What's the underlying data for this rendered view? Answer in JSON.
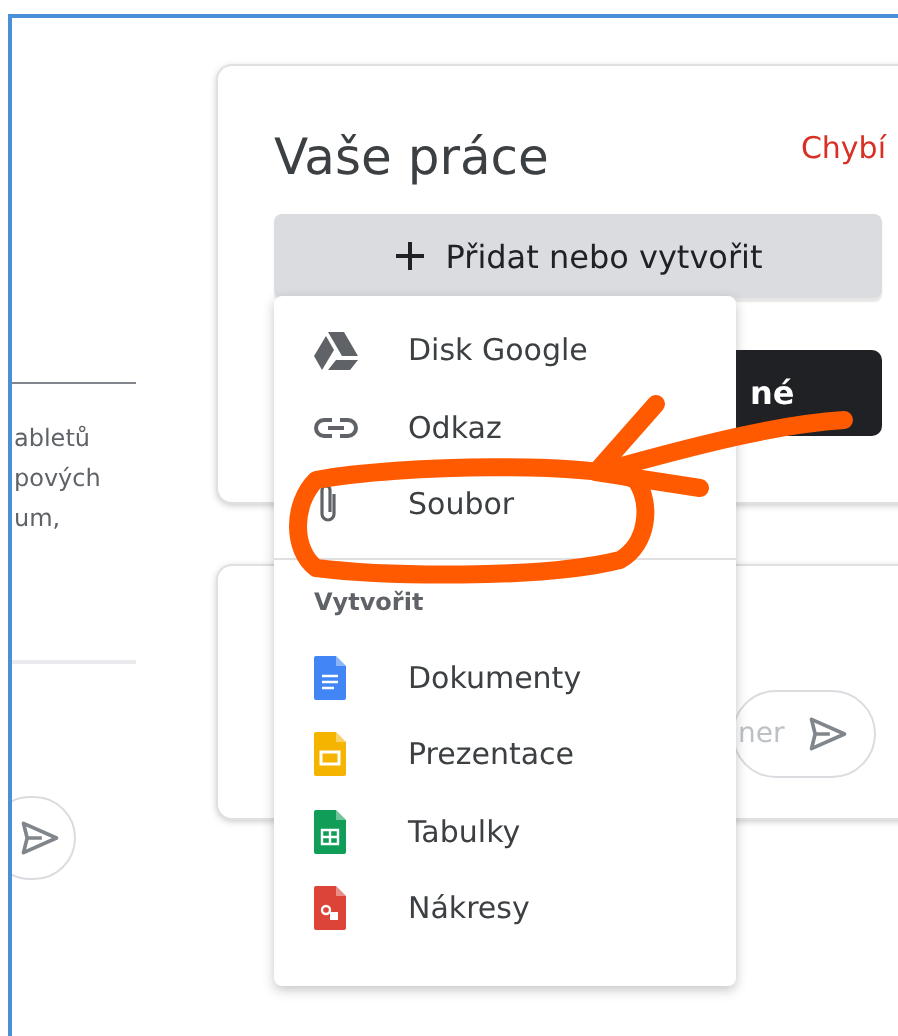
{
  "left_panel": {
    "text_lines": [
      "abletů",
      "pových",
      "um,"
    ]
  },
  "work_card": {
    "title": "Vaše práce",
    "status": "Chybí",
    "add_button": "Přidat nebo vytvořit",
    "submit_button": "né"
  },
  "comment_card": {
    "placeholder": "ner"
  },
  "menu": {
    "items": [
      {
        "label": "Disk Google",
        "kind": "drive"
      },
      {
        "label": "Odkaz",
        "kind": "link"
      },
      {
        "label": "Soubor",
        "kind": "file"
      }
    ],
    "section": "Vytvořit",
    "create_items": [
      {
        "label": "Dokumenty",
        "kind": "docs"
      },
      {
        "label": "Prezentace",
        "kind": "slides"
      },
      {
        "label": "Tabulky",
        "kind": "sheets"
      },
      {
        "label": "Nákresy",
        "kind": "drawings"
      }
    ]
  }
}
